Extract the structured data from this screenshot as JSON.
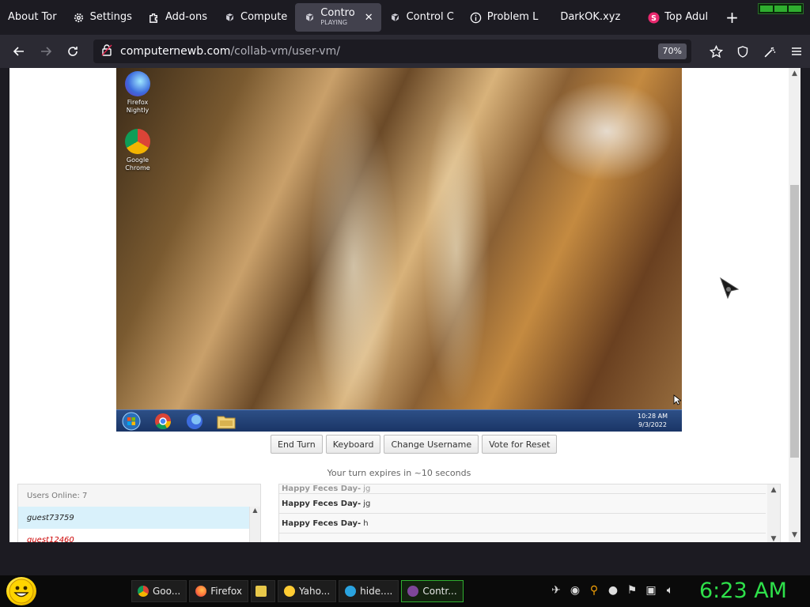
{
  "tabs": [
    {
      "label": "About Tor",
      "icon": "tor-icon"
    },
    {
      "label": "Settings",
      "icon": "gear-icon"
    },
    {
      "label": "Add-ons",
      "icon": "puzzle-icon"
    },
    {
      "label": "Compute",
      "icon": "vm-icon"
    },
    {
      "label": "Contro",
      "sub": "PLAYING",
      "icon": "vm-icon",
      "active": true
    },
    {
      "label": "Control C",
      "icon": "vm-icon"
    },
    {
      "label": "Problem L",
      "icon": "info-icon"
    },
    {
      "label": "DarkOK.xyz",
      "icon": ""
    },
    {
      "label": "Top Adul",
      "icon": "s-logo-icon"
    }
  ],
  "url": {
    "host": "computernewb.com",
    "path": "/collab-vm/user-vm/",
    "zoom": "70%"
  },
  "vm": {
    "desktop_icons": [
      {
        "line1": "Firefox",
        "line2": "Nightly"
      },
      {
        "line1": "Google",
        "line2": "Chrome"
      }
    ],
    "clock_time": "10:28 AM",
    "clock_date": "9/3/2022"
  },
  "controls": {
    "end_turn": "End Turn",
    "keyboard": "Keyboard",
    "change_username": "Change Username",
    "vote_reset": "Vote for Reset"
  },
  "turn_message": "Your turn expires in ~10 seconds",
  "users": {
    "header": "Users Online: 7",
    "list": [
      "guest73759",
      "guest12460"
    ]
  },
  "chat": [
    {
      "user": "Happy Feces Day-",
      "text": "jg"
    },
    {
      "user": "Happy Feces Day-",
      "text": "jg"
    },
    {
      "user": "Happy Feces Day-",
      "text": "h"
    }
  ],
  "taskbar": {
    "tasks": [
      {
        "label": "Goo...",
        "color": "#4285f4"
      },
      {
        "label": "Firefox",
        "color": "#ff7139"
      },
      {
        "label": "",
        "color": "#e8c84a"
      },
      {
        "label": "Yaho...",
        "color": "#ffcc33"
      },
      {
        "label": "hide....",
        "color": "#2aa3e0"
      },
      {
        "label": "Contr...",
        "color": "#7d4698"
      }
    ],
    "clock": "6:23 AM"
  }
}
